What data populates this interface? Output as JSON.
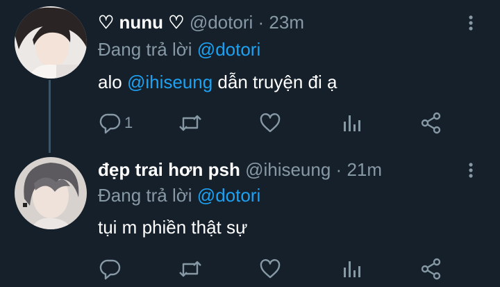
{
  "tweets": [
    {
      "display_name": "♡ nunu ♡",
      "handle": "@dotori",
      "separator": "·",
      "time": "23m",
      "reply_prefix": "Đang trả lời",
      "reply_to": "@dotori",
      "body_pre": "alo",
      "body_mention": "@ihiseung",
      "body_post": "dẫn truyện đi ạ",
      "reply_count": "1"
    },
    {
      "display_name": "đẹp trai hơn psh",
      "handle": "@ihiseung",
      "separator": "·",
      "time": "21m",
      "reply_prefix": "Đang trả lời",
      "reply_to": "@dotori",
      "body": "tụi m phiền thật sự",
      "reply_count": ""
    }
  ],
  "colors": {
    "background": "#15202b",
    "text_primary": "#ffffff",
    "text_secondary": "#8899a6",
    "accent": "#1da1f2",
    "thread_line": "#3d5466"
  },
  "icons": {
    "more": "more-vertical-icon",
    "reply": "reply-icon",
    "retweet": "retweet-icon",
    "like": "heart-icon",
    "stats": "analytics-icon",
    "share": "share-icon"
  }
}
